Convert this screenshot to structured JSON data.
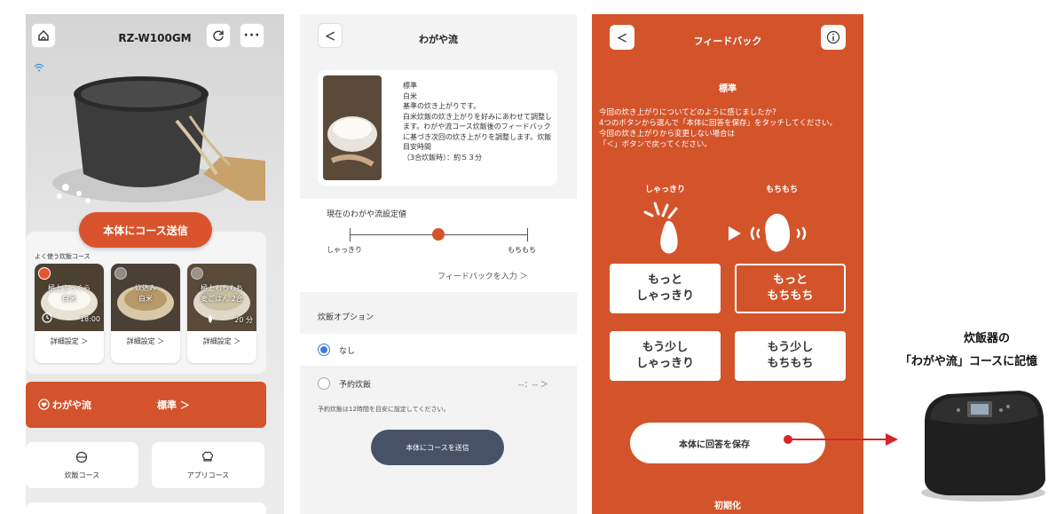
{
  "screen1": {
    "title": "RZ-W100GM",
    "send_button": "本体にコース送信",
    "favorites_label": "よく使う炊飯コース",
    "cards": [
      {
        "name": "極上ふっくら\n白米",
        "time": "18:00",
        "detail": "詳細設定 ＞",
        "selected": true
      },
      {
        "name": "炊込み\n白米",
        "time": "",
        "detail": "詳細設定 ＞",
        "selected": false
      },
      {
        "name": "極上もちもち\n麦ごはん 2合",
        "time": "20 分",
        "detail": "詳細設定 ＞",
        "selected": false
      }
    ],
    "wagaya": {
      "label": "わがや流",
      "value": "標準 ＞"
    },
    "menu": [
      {
        "label": "炊飯コース",
        "icon": "rice-pot-icon"
      },
      {
        "label": "アプリコース",
        "icon": "chef-hat-icon"
      }
    ]
  },
  "screen2": {
    "title": "わがや流",
    "description": "標準\n白米\n基準の炊き上がりです。\n白米炊飯の炊き上がりを好みにあわせて調整します。わがや流コース炊飯後のフィードバックに基づき次回の炊き上がりを調整します。炊飯目安時間\n（3合炊飯時）：約５３分",
    "setting_label": "現在のわがや流設定値",
    "slider_left": "しゃっきり",
    "slider_right": "もちもち",
    "slider_value": 0.5,
    "feedback_link": "フィードバックを入力 ＞",
    "options_label": "炊飯オプション",
    "option_none": "なし",
    "option_timer": "予約炊飯",
    "timer_value": "--：-- ＞",
    "timer_note": "予約炊飯は12時間を目安に設定してください。",
    "send_button": "本体にコースを送信"
  },
  "screen3": {
    "title": "フィードバック",
    "subtitle": "標準",
    "instructions": "今回の炊き上がりについてどのように感じましたか？\n4つのボタンから選んで「本体に回答を保存」をタッチしてください。\n今回の炊き上がりから変更しない場合は\n「＜」ボタンで戻ってください。",
    "label_left": "しゃっきり",
    "label_right": "もちもち",
    "buttons": [
      "もっと\nしゃっきり",
      "もっと\nもちもち",
      "もう少し\nしゃっきり",
      "もう少し\nもちもち"
    ],
    "save_button": "本体に回答を保存",
    "reset": "初期化"
  },
  "annotation": {
    "line1": "炊飯器の",
    "line2": "「わがや流」コースに記憶"
  },
  "colors": {
    "accent": "#d3542b",
    "dark_button": "#475266",
    "radio_blue": "#3d7be0"
  }
}
